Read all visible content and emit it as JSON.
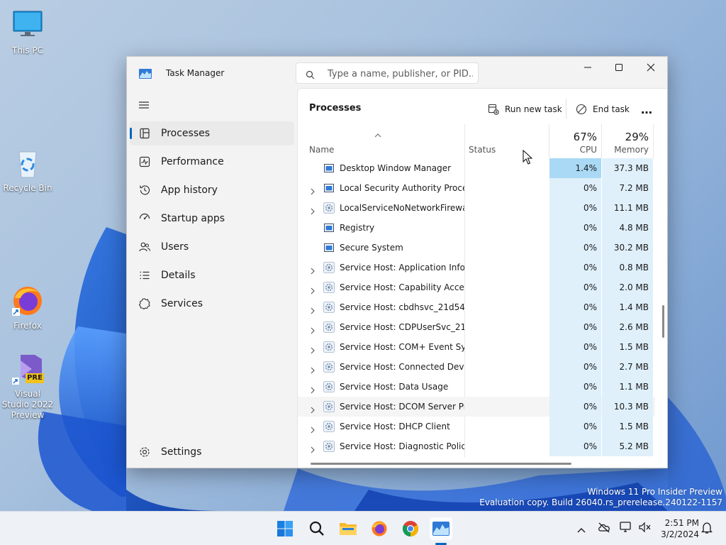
{
  "desktop": {
    "icons": [
      {
        "label": "This PC",
        "icon": "monitor-icon"
      },
      {
        "label": "Recycle Bin",
        "icon": "recycle-bin-icon"
      },
      {
        "label": "Firefox",
        "icon": "firefox-icon"
      },
      {
        "label": "Visual Studio 2022 Preview",
        "icon": "visual-studio-icon",
        "badge": "PRE"
      }
    ],
    "watermark": {
      "line1": "Windows 11 Pro Insider Preview",
      "line2": "Evaluation copy. Build 26040.rs_prerelease.240122-1157"
    }
  },
  "window": {
    "title": "Task Manager",
    "search_placeholder": "Type a name, publisher, or PID...",
    "accent": "#0067c0"
  },
  "sidebar": {
    "items": [
      {
        "label": "Processes",
        "icon": "processes-icon",
        "active": true
      },
      {
        "label": "Performance",
        "icon": "performance-icon"
      },
      {
        "label": "App history",
        "icon": "app-history-icon"
      },
      {
        "label": "Startup apps",
        "icon": "startup-apps-icon"
      },
      {
        "label": "Users",
        "icon": "users-icon"
      },
      {
        "label": "Details",
        "icon": "details-icon"
      },
      {
        "label": "Services",
        "icon": "services-icon"
      }
    ],
    "settings_label": "Settings"
  },
  "main": {
    "title": "Processes",
    "run_new_task": "Run new task",
    "end_task": "End task",
    "more": "…",
    "columns": {
      "name": "Name",
      "status": "Status",
      "cpu_label": "CPU",
      "cpu_pct": "67%",
      "memory_label": "Memory",
      "memory_pct": "29%"
    },
    "rows": [
      {
        "name": "Desktop Window Manager",
        "cpu": "1.4%",
        "memory": "37.3 MB",
        "expandable": false,
        "icon": "window-app-icon",
        "cpu_highlight": true
      },
      {
        "name": "Local Security Authority Proce...",
        "cpu": "0%",
        "memory": "7.2 MB",
        "expandable": true,
        "icon": "window-app-icon"
      },
      {
        "name": "LocalServiceNoNetworkFirewa...",
        "cpu": "0%",
        "memory": "11.1 MB",
        "expandable": true,
        "icon": "gear-service-icon"
      },
      {
        "name": "Registry",
        "cpu": "0%",
        "memory": "4.8 MB",
        "expandable": false,
        "icon": "window-app-icon"
      },
      {
        "name": "Secure System",
        "cpu": "0%",
        "memory": "30.2 MB",
        "expandable": false,
        "icon": "window-app-icon"
      },
      {
        "name": "Service Host: Application Infor...",
        "cpu": "0%",
        "memory": "0.8 MB",
        "expandable": true,
        "icon": "gear-service-icon"
      },
      {
        "name": "Service Host: Capability Acces...",
        "cpu": "0%",
        "memory": "2.0 MB",
        "expandable": true,
        "icon": "gear-service-icon"
      },
      {
        "name": "Service Host: cbdhsvc_21d54",
        "cpu": "0%",
        "memory": "1.4 MB",
        "expandable": true,
        "icon": "gear-service-icon"
      },
      {
        "name": "Service Host: CDPUserSvc_21d...",
        "cpu": "0%",
        "memory": "2.6 MB",
        "expandable": true,
        "icon": "gear-service-icon"
      },
      {
        "name": "Service Host: COM+ Event Sys...",
        "cpu": "0%",
        "memory": "1.5 MB",
        "expandable": true,
        "icon": "gear-service-icon"
      },
      {
        "name": "Service Host: Connected Devi...",
        "cpu": "0%",
        "memory": "2.7 MB",
        "expandable": true,
        "icon": "gear-service-icon"
      },
      {
        "name": "Service Host: Data Usage",
        "cpu": "0%",
        "memory": "1.1 MB",
        "expandable": true,
        "icon": "gear-service-icon"
      },
      {
        "name": "Service Host: DCOM Server Pr...",
        "cpu": "0%",
        "memory": "10.3 MB",
        "expandable": true,
        "icon": "gear-service-icon",
        "hover": true
      },
      {
        "name": "Service Host: DHCP Client",
        "cpu": "0%",
        "memory": "1.5 MB",
        "expandable": true,
        "icon": "gear-service-icon"
      },
      {
        "name": "Service Host: Diagnostic Polic...",
        "cpu": "0%",
        "memory": "5.2 MB",
        "expandable": true,
        "icon": "gear-service-icon"
      }
    ]
  },
  "taskbar": {
    "apps": [
      "windows-start-icon",
      "search-icon",
      "file-explorer-icon",
      "firefox-icon",
      "chrome-icon",
      "task-manager-icon"
    ],
    "time": "2:51 PM",
    "date": "3/2/2024"
  }
}
